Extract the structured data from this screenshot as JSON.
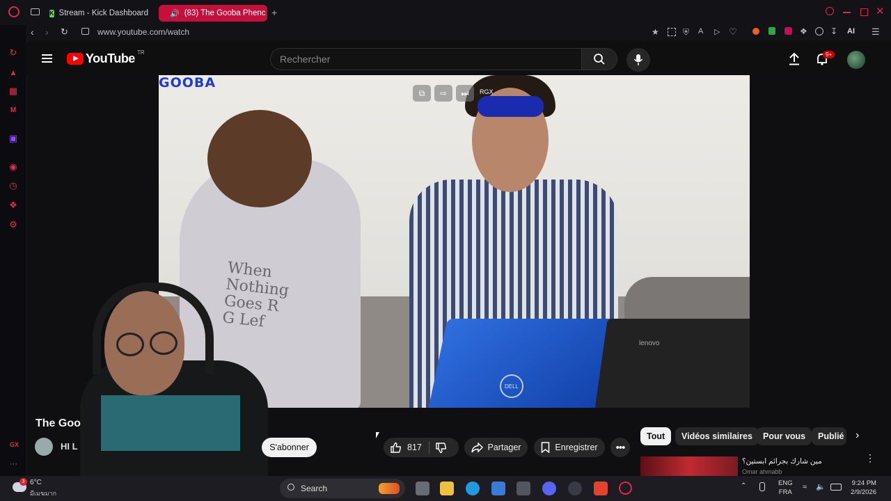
{
  "browser": {
    "tabs": [
      {
        "label": "Stream - Kick Dashboard",
        "active": false
      },
      {
        "label": "(83) The Gooba Phenc",
        "active": true
      }
    ],
    "url": "www.youtube.com/watch",
    "toolbar_ai_label": "AI",
    "accent_color": "#c4103a"
  },
  "sidebar": {
    "gx_label": "GX",
    "items": [
      "speed-dial-icon",
      "bag-icon",
      "controller-icon",
      "messenger-icon",
      "twitch-icon",
      "player-icon",
      "history-icon",
      "extensions-icon",
      "settings-icon"
    ]
  },
  "youtube": {
    "logo_text": "YouTube",
    "region": "TR",
    "search_placeholder": "Rechercher",
    "notifications_badge": "9+"
  },
  "video": {
    "watermark": "GOOBA",
    "overlay_label": "RGX",
    "shirt_text": "When\nNothing\nGoes R\nG Lef",
    "laptop_brand_left": "DELL",
    "laptop_brand_right": "lenovo"
  },
  "watch": {
    "title": "The Goo",
    "channel": "HI L",
    "subscribe_label": "S'abonner",
    "like_count": "817",
    "share_label": "Partager",
    "save_label": "Enregistrer"
  },
  "chips": [
    "Tout",
    "Vidéos similaires",
    "Pour vous",
    "Publié"
  ],
  "recommendation": {
    "title": "مين شارك بجرائم ابستين؟",
    "channel": "Omar ahmabb"
  },
  "taskbar": {
    "weather_temp": "6°C",
    "weather_cond": "มีเมฆมาก",
    "weather_badge": "3",
    "search_label": "Search",
    "lang1": "ENG",
    "lang2": "FRA",
    "time": "9:24 PM",
    "date": "2/9/2026"
  }
}
